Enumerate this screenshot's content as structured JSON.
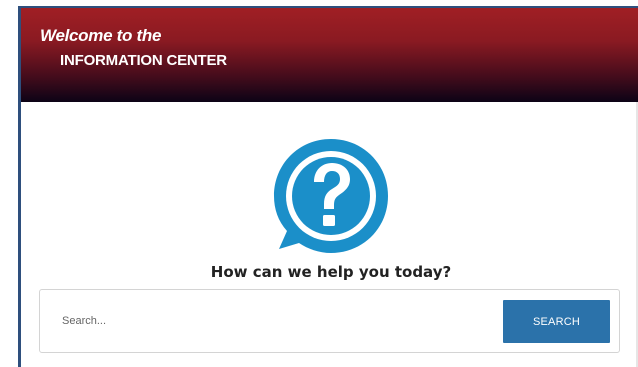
{
  "header": {
    "welcome_text": "Welcome to the",
    "title": "INFORMATION CENTER"
  },
  "main": {
    "icon": "question-mark-speech-bubble-icon",
    "heading": "How can we help you today?",
    "search": {
      "placeholder": "Search...",
      "value": "",
      "button_label": "SEARCH"
    }
  },
  "colors": {
    "header_top": "#a01f24",
    "header_bottom": "#0c0316",
    "icon_blue": "#1b8fc9",
    "button_blue": "#2b72aa",
    "frame_border": "#2e4f7d"
  }
}
